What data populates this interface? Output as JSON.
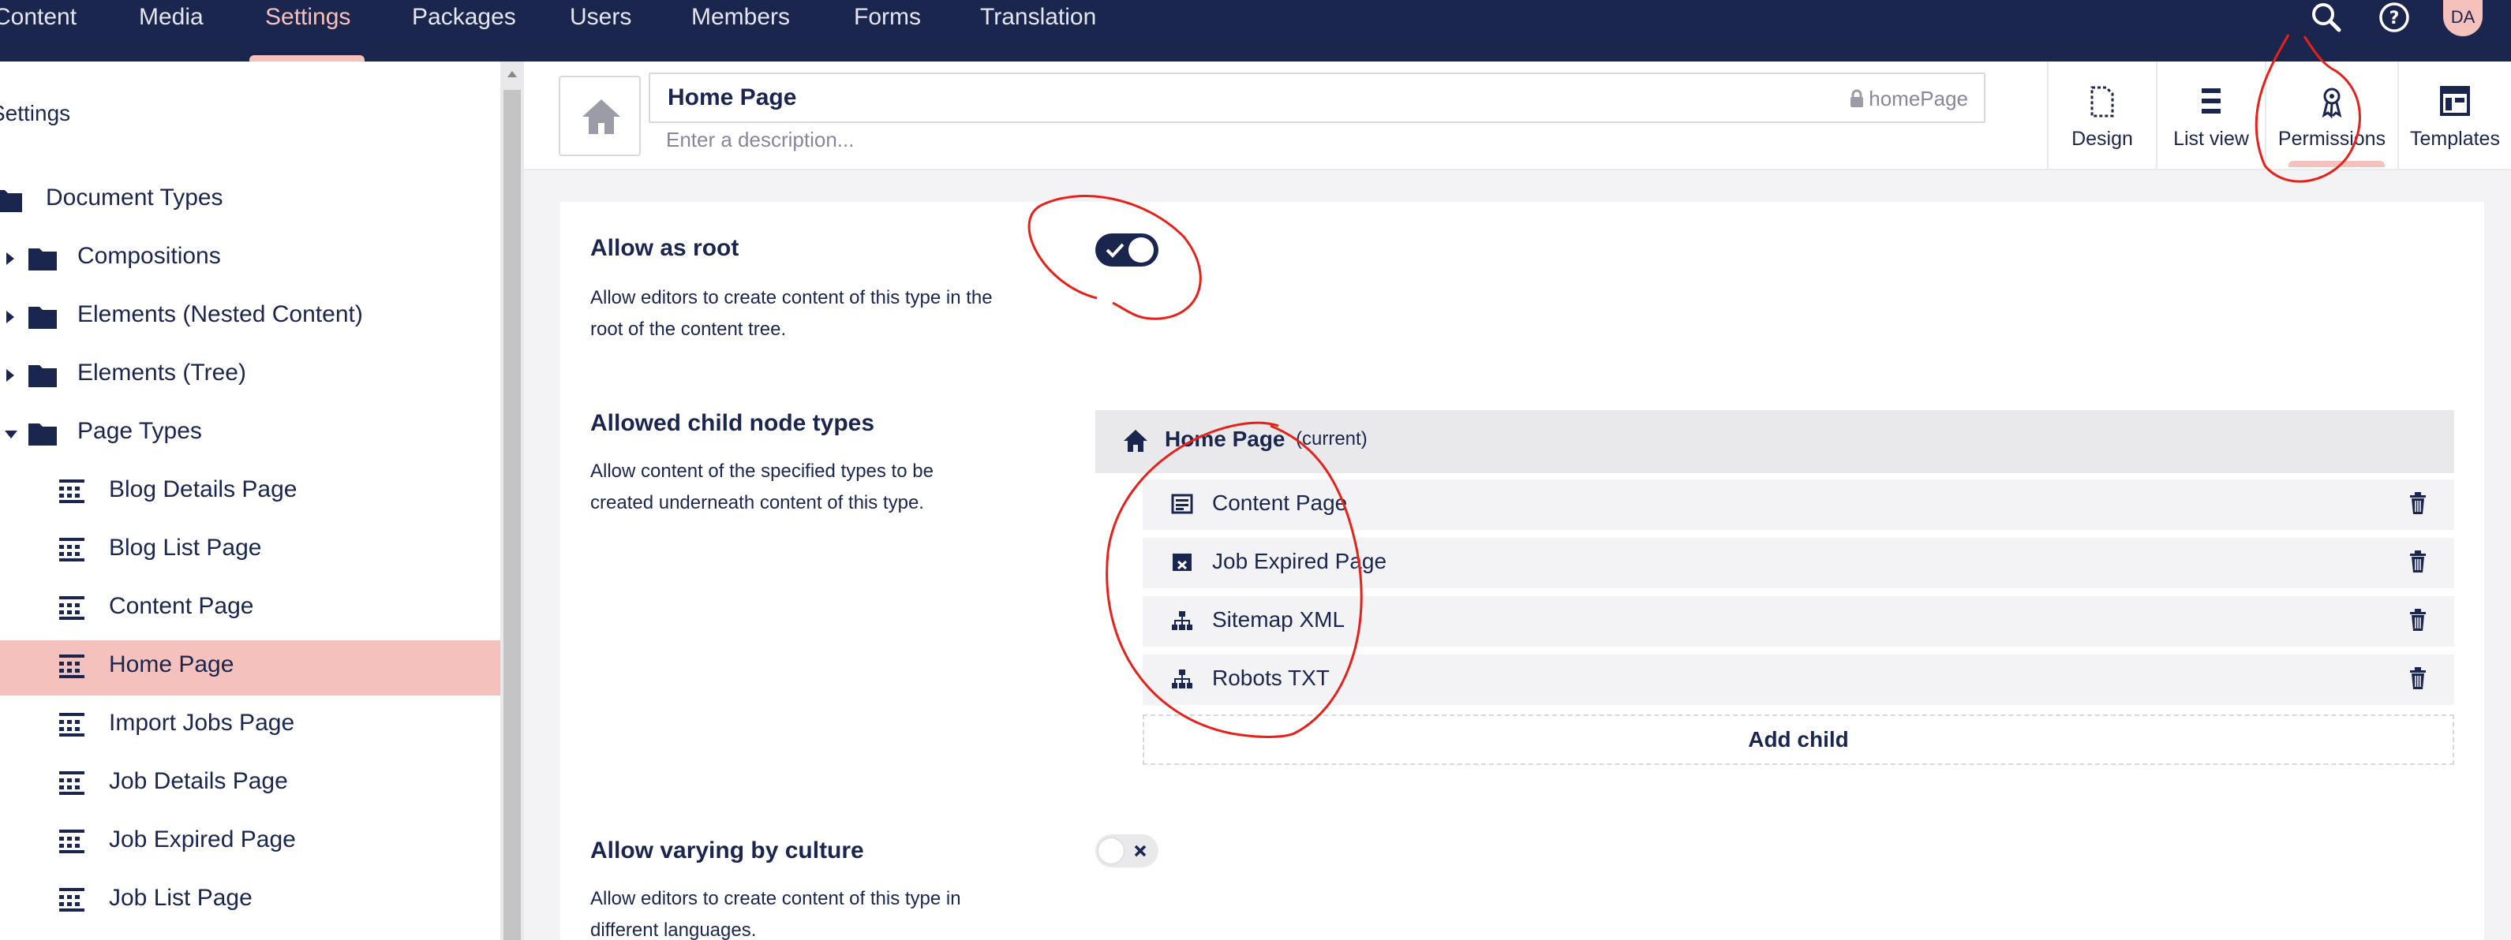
{
  "topnav": {
    "items": [
      {
        "label": "Content"
      },
      {
        "label": "Media"
      },
      {
        "label": "Settings",
        "active": true
      },
      {
        "label": "Packages"
      },
      {
        "label": "Users"
      },
      {
        "label": "Members"
      },
      {
        "label": "Forms"
      },
      {
        "label": "Translation"
      }
    ],
    "icons": [
      "search-icon",
      "help-icon"
    ],
    "avatar_initials": "DA"
  },
  "sidebar": {
    "title": "Settings",
    "tree": [
      {
        "label": "Document Types",
        "kind": "folder",
        "level": 0,
        "caret": "none"
      },
      {
        "label": "Compositions",
        "kind": "folder",
        "level": 1,
        "caret": "right"
      },
      {
        "label": "Elements (Nested Content)",
        "kind": "folder",
        "level": 1,
        "caret": "right"
      },
      {
        "label": "Elements (Tree)",
        "kind": "folder",
        "level": 1,
        "caret": "right"
      },
      {
        "label": "Page Types",
        "kind": "folder",
        "level": 1,
        "caret": "down"
      },
      {
        "label": "Blog Details Page",
        "kind": "doctype",
        "level": 2
      },
      {
        "label": "Blog List Page",
        "kind": "doctype",
        "level": 2
      },
      {
        "label": "Content Page",
        "kind": "doctype",
        "level": 2
      },
      {
        "label": "Home Page",
        "kind": "doctype",
        "level": 2,
        "selected": true
      },
      {
        "label": "Import Jobs Page",
        "kind": "doctype",
        "level": 2
      },
      {
        "label": "Job Details Page",
        "kind": "doctype",
        "level": 2
      },
      {
        "label": "Job Expired Page",
        "kind": "doctype",
        "level": 2
      },
      {
        "label": "Job List Page",
        "kind": "doctype",
        "level": 2
      }
    ]
  },
  "header": {
    "name": "Home Page",
    "alias": "homePage",
    "description_placeholder": "Enter a description...",
    "apps": [
      {
        "label": "Design",
        "icon": "document-icon"
      },
      {
        "label": "List view",
        "icon": "list-icon"
      },
      {
        "label": "Permissions",
        "icon": "permissions-icon",
        "active": true
      },
      {
        "label": "Templates",
        "icon": "templates-icon"
      }
    ]
  },
  "permissions": {
    "allow_root": {
      "label": "Allow as root",
      "description": "Allow editors to create content of this type in the root of the content tree.",
      "enabled": true
    },
    "child_types": {
      "label": "Allowed child node types",
      "description": "Allow content of the specified types to be created underneath content of this type.",
      "parent_name": "Home Page",
      "parent_suffix": "(current)",
      "children": [
        {
          "name": "Content Page",
          "icon": "content-page-icon"
        },
        {
          "name": "Job Expired Page",
          "icon": "expired-page-icon"
        },
        {
          "name": "Sitemap XML",
          "icon": "sitemap-icon"
        },
        {
          "name": "Robots TXT",
          "icon": "sitemap-icon"
        }
      ],
      "add_label": "Add child"
    },
    "vary_culture": {
      "label": "Allow varying by culture",
      "description": "Allow editors to create content of this type in different languages.",
      "enabled": false
    }
  },
  "colors": {
    "navy": "#1b264f",
    "pink": "#f5c1bc",
    "annotation_red": "#e8201a"
  }
}
